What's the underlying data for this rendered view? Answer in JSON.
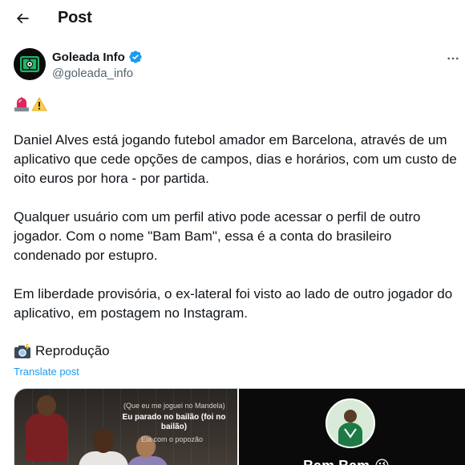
{
  "header": {
    "title": "Post"
  },
  "author": {
    "display_name": "Goleada Info",
    "handle": "@goleada_info",
    "verified_icon": "verified-badge-icon",
    "verified_color": "#1d9bf0"
  },
  "post": {
    "emojis": [
      "🚨",
      "⚠️"
    ],
    "paragraphs": [
      "Daniel Alves está jogando futebol amador em Barcelona, através de um aplicativo que cede opções de campos, dias e horários, com um custo de oito euros por hora - por partida.",
      "Qualquer usuário com um perfil ativo pode acessar o perfil de outro jogador. Com o nome \"Bam Bam\", essa é a conta do brasileiro condenado por estupro.",
      "Em liberdade provisória, o ex-lateral foi visto ao lado de outro jogador do aplicativo, em postagem no Instagram."
    ],
    "credit_emoji": "📸",
    "credit_text": "Reprodução",
    "translate_label": "Translate post"
  },
  "media": {
    "image1": {
      "caption_top": "(Que eu me joguei no Mandela)",
      "caption_main": "Eu parado no bailão (foi no bailão)",
      "caption_sub": "Ela com o popozão"
    },
    "image2": {
      "profile_name": "Bam Bam",
      "profile_emoji": "😉"
    }
  },
  "colors": {
    "text_primary": "#0f1419",
    "text_secondary": "#536471",
    "link": "#1d9bf0",
    "border": "#cfd9de"
  }
}
